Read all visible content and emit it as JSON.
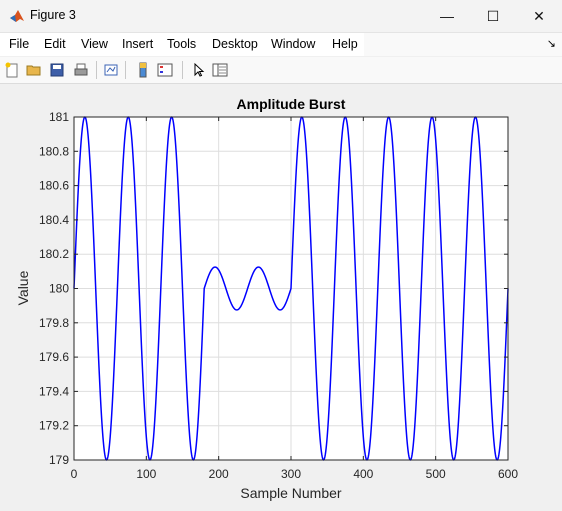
{
  "window": {
    "title": "Figure 3",
    "controls": {
      "minimize": "—",
      "maximize": "☐",
      "close": "✕"
    }
  },
  "menu": {
    "items": [
      "File",
      "Edit",
      "View",
      "Insert",
      "Tools",
      "Desktop",
      "Window",
      "Help"
    ],
    "overflow_icon": "↘"
  },
  "toolbar": {
    "icons": [
      "new-figure-icon",
      "open-file-icon",
      "save-icon",
      "print-icon",
      "link-plot-icon",
      "colorbar-icon",
      "legend-icon",
      "pointer-icon",
      "property-inspector-icon"
    ]
  },
  "colors": {
    "line": "#0000ff",
    "grid": "#dedede",
    "axes": "#262626"
  },
  "chart_data": {
    "type": "line",
    "title": "Amplitude Burst",
    "xlabel": "Sample Number",
    "ylabel": "Value",
    "xlim": [
      0,
      600
    ],
    "ylim": [
      179,
      181
    ],
    "xticks": [
      "0",
      "100",
      "200",
      "300",
      "400",
      "500",
      "600"
    ],
    "yticks": [
      "179",
      "179.2",
      "179.4",
      "179.6",
      "179.8",
      "180",
      "180.2",
      "180.4",
      "180.6",
      "180.8",
      "181"
    ],
    "grid": true,
    "series": [
      {
        "description": "sine wave, period 60 samples, center 180",
        "segments": [
          {
            "x_range": [
              0,
              180
            ],
            "amplitude": 1,
            "period": 60,
            "center": 180
          },
          {
            "x_range": [
              180,
              300
            ],
            "amplitude": 0.125,
            "period": 60,
            "center": 180
          },
          {
            "x_range": [
              300,
              600
            ],
            "amplitude": 1,
            "period": 60,
            "center": 180
          }
        ]
      }
    ]
  }
}
